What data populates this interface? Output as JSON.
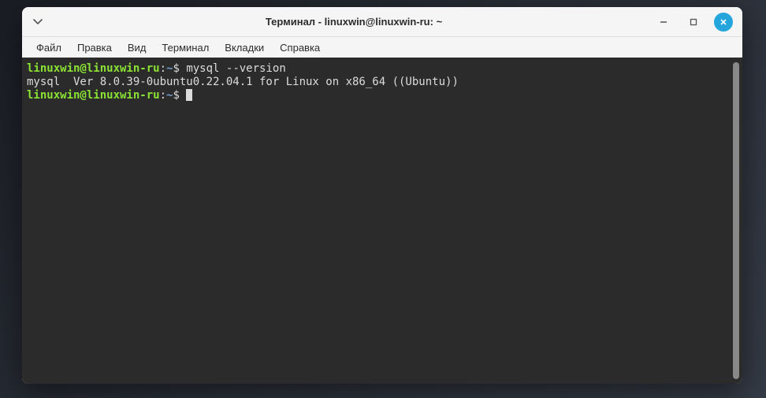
{
  "window": {
    "title": "Терминал - linuxwin@linuxwin-ru: ~"
  },
  "menubar": {
    "items": [
      "Файл",
      "Правка",
      "Вид",
      "Терминал",
      "Вкладки",
      "Справка"
    ]
  },
  "terminal": {
    "prompt1": {
      "userhost": "linuxwin@linuxwin-ru",
      "sep": ":",
      "path": "~",
      "dollar": "$"
    },
    "command1": " mysql --version",
    "output1": "mysql  Ver 8.0.39-0ubuntu0.22.04.1 for Linux on x86_64 ((Ubuntu))",
    "prompt2": {
      "userhost": "linuxwin@linuxwin-ru",
      "sep": ":",
      "path": "~",
      "dollar": "$"
    },
    "command2": " "
  }
}
